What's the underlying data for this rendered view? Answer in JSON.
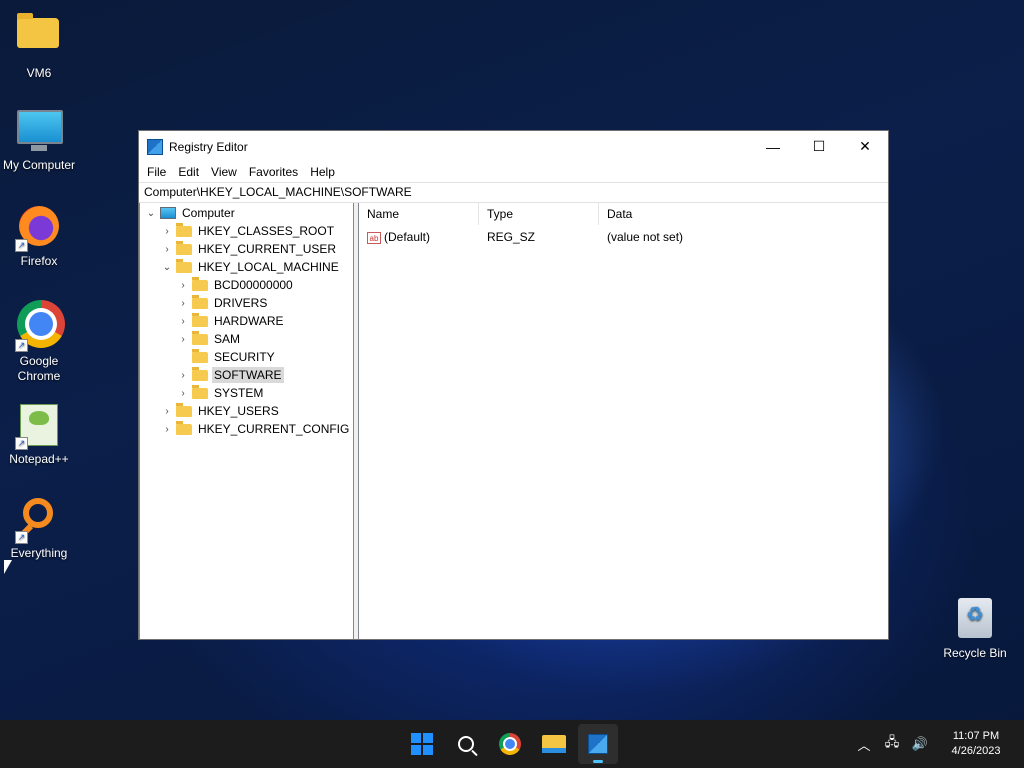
{
  "desktop": {
    "icons": [
      {
        "label": "VM6",
        "icon": "folder-icon"
      },
      {
        "label": "My Computer",
        "icon": "monitor-icon"
      },
      {
        "label": "Firefox",
        "icon": "firefox-icon"
      },
      {
        "label": "Google Chrome",
        "icon": "chrome-icon"
      },
      {
        "label": "Notepad++",
        "icon": "notepadpp-icon"
      },
      {
        "label": "Everything",
        "icon": "everything-icon"
      },
      {
        "label": "Recycle Bin",
        "icon": "recycle-bin-icon"
      }
    ]
  },
  "window": {
    "title": "Registry Editor",
    "controls": {
      "minimize": "—",
      "maximize": "☐",
      "close": "✕"
    },
    "menu": [
      "File",
      "Edit",
      "View",
      "Favorites",
      "Help"
    ],
    "address": "Computer\\HKEY_LOCAL_MACHINE\\SOFTWARE",
    "tree": [
      {
        "label": "Computer",
        "expander": "⌄"
      },
      {
        "label": "HKEY_CLASSES_ROOT",
        "expander": "›"
      },
      {
        "label": "HKEY_CURRENT_USER",
        "expander": "›"
      },
      {
        "label": "HKEY_LOCAL_MACHINE",
        "expander": "⌄"
      },
      {
        "label": "BCD00000000",
        "expander": "›"
      },
      {
        "label": "DRIVERS",
        "expander": "›"
      },
      {
        "label": "HARDWARE",
        "expander": "›"
      },
      {
        "label": "SAM",
        "expander": "›"
      },
      {
        "label": "SECURITY",
        "expander": ""
      },
      {
        "label": "SOFTWARE",
        "expander": "›",
        "selected": true
      },
      {
        "label": "SYSTEM",
        "expander": "›"
      },
      {
        "label": "HKEY_USERS",
        "expander": "›"
      },
      {
        "label": "HKEY_CURRENT_CONFIG",
        "expander": "›"
      }
    ],
    "columns": {
      "name": "Name",
      "type": "Type",
      "data": "Data"
    },
    "values": [
      {
        "icon_text": "ab",
        "name": "(Default)",
        "type": "REG_SZ",
        "data": "(value not set)"
      }
    ]
  },
  "taskbar": {
    "apps": [
      "start-icon",
      "search-icon",
      "chrome-icon",
      "file-explorer-icon",
      "registry-editor-icon"
    ],
    "active_app": "registry-editor-icon",
    "tray": {
      "chevron": "︿",
      "network": "🖧",
      "volume": "🔊"
    },
    "time": "11:07 PM",
    "date": "4/26/2023"
  }
}
